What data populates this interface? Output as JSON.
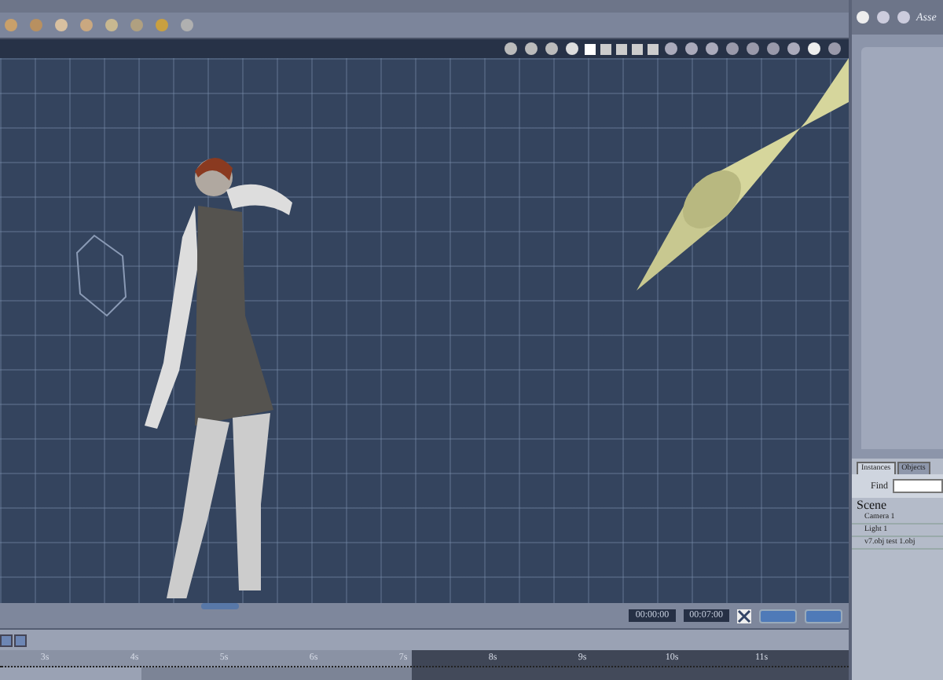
{
  "header": {
    "text": "Asse"
  },
  "scene_panel": {
    "tabs": [
      {
        "label": "Instances",
        "selected": true
      },
      {
        "label": "Objects",
        "selected": false
      }
    ],
    "find": {
      "label": "Find"
    },
    "tree": {
      "label": "Scene",
      "children": [
        {
          "label": "Camera 1"
        },
        {
          "label": "Light 1"
        },
        {
          "label": "v7.obj test 1.obj"
        }
      ]
    }
  },
  "timeline": {
    "start_time": "00:00:00",
    "end_time": "00:07:00",
    "ticks": [
      "3s",
      "4s",
      "5s",
      "6s",
      "7s",
      "8s",
      "9s",
      "10s",
      "11s"
    ]
  }
}
